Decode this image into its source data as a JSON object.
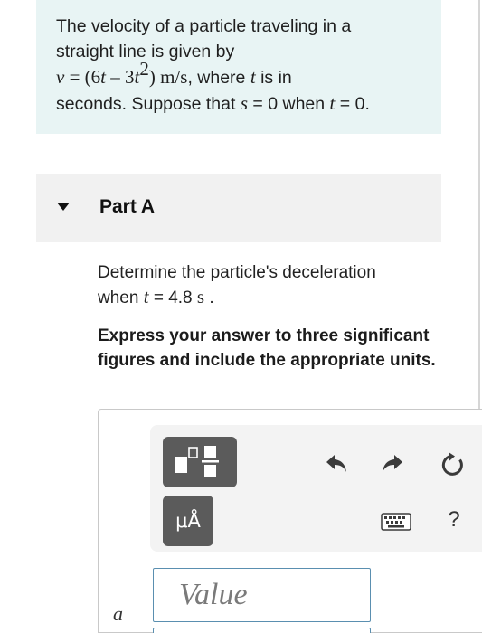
{
  "problem": {
    "line1": "The velocity of a particle traveling in a",
    "line2": "straight line is given by",
    "v_var": "v",
    "eq_open": " = (6",
    "t1": "t",
    "minus": " – 3",
    "t2": "t",
    "exp": "2",
    "eq_close": ") m/s",
    "line3_rest": ", where ",
    "t3": "t",
    "line3_end": " is in",
    "line4_start": "seconds. Suppose that ",
    "s_var": "s",
    "line4_mid": " = 0 when ",
    "t4": "t",
    "line4_end": " = 0."
  },
  "part": {
    "title": "Part A"
  },
  "question": {
    "line1": "Determine the particle's deceleration",
    "line2_start": "when ",
    "t_var": "t",
    "line2_mid": " = 4.8 ",
    "unit": "s",
    "line2_end": " ."
  },
  "instructions": {
    "text": "Express your answer to three significant figures and include the appropriate units."
  },
  "toolbar": {
    "units_label": "μÅ",
    "help_label": "?"
  },
  "answer": {
    "variable": "a",
    "value_placeholder": "Value"
  },
  "colors": {
    "problem_bg": "#e8f4f4",
    "part_bg": "#f1f1f1",
    "tool_button": "#5b5b5b",
    "input_border": "#5a8fb0"
  },
  "icons": [
    "templates-icon",
    "units-icon",
    "undo-icon",
    "redo-icon",
    "reset-icon",
    "keyboard-icon",
    "help-icon",
    "collapse-triangle-icon"
  ]
}
